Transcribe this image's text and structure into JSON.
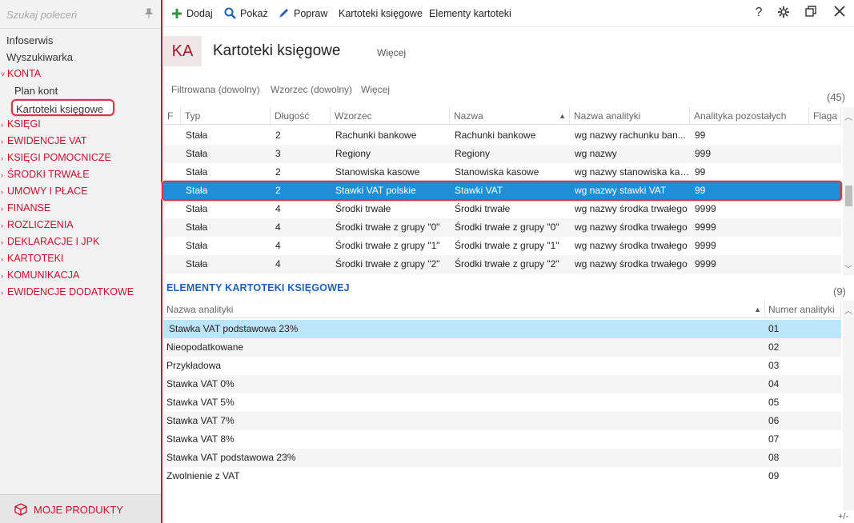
{
  "sidebar": {
    "search_placeholder": "Szukaj poleceń",
    "items": [
      {
        "label": "Infoserwis",
        "kind": "plain"
      },
      {
        "label": "Wyszukiwarka",
        "kind": "plain"
      },
      {
        "label": "KONTA",
        "kind": "section-open"
      },
      {
        "label": "Plan kont",
        "kind": "sub"
      },
      {
        "label": "Kartoteki księgowe",
        "kind": "sub-active"
      },
      {
        "label": "KSIĘGI",
        "kind": "section"
      },
      {
        "label": "EWIDENCJE VAT",
        "kind": "section"
      },
      {
        "label": "KSIĘGI POMOCNICZE",
        "kind": "section"
      },
      {
        "label": "ŚRODKI TRWAŁE",
        "kind": "section"
      },
      {
        "label": "UMOWY I PŁACE",
        "kind": "section"
      },
      {
        "label": "FINANSE",
        "kind": "section"
      },
      {
        "label": "ROZLICZENIA",
        "kind": "section"
      },
      {
        "label": "DEKLARACJE I JPK",
        "kind": "section"
      },
      {
        "label": "KARTOTEKI",
        "kind": "section"
      },
      {
        "label": "KOMUNIKACJA",
        "kind": "section"
      },
      {
        "label": "EWIDENCJE DODATKOWE",
        "kind": "section"
      }
    ],
    "footer_label": "MOJE PRODUKTY"
  },
  "toolbar": {
    "add": "Dodaj",
    "show": "Pokaż",
    "edit": "Popraw",
    "cards": "Kartoteki księgowe",
    "elements": "Elementy kartoteki"
  },
  "header": {
    "badge": "KA",
    "title": "Kartoteki księgowe",
    "more": "Więcej"
  },
  "filters": {
    "filtered": "Filtrowana (dowolny)",
    "pattern": "Wzorzec (dowolny)",
    "more": "Więcej",
    "count": "(45)"
  },
  "table1": {
    "columns": [
      "F",
      "Typ",
      "Długość",
      "Wzorzec",
      "Nazwa",
      "Nazwa analityki",
      "Analityka pozostałych",
      "Flaga"
    ],
    "rows": [
      [
        "",
        "Stała",
        "2",
        "Rachunki bankowe",
        "Rachunki bankowe",
        "wg nazwy rachunku ban...",
        "99",
        ""
      ],
      [
        "",
        "Stała",
        "3",
        "Regiony",
        "Regiony",
        "wg nazwy",
        "999",
        ""
      ],
      [
        "",
        "Stała",
        "2",
        "Stanowiska kasowe",
        "Stanowiska kasowe",
        "wg nazwy stanowiska kas...",
        "99",
        ""
      ],
      [
        "",
        "Stała",
        "2",
        "Stawki VAT polskie",
        "Stawki VAT",
        "wg nazwy stawki VAT",
        "99",
        ""
      ],
      [
        "",
        "Stała",
        "4",
        "Środki trwałe",
        "Środki trwałe",
        "wg nazwy środka trwałego",
        "9999",
        ""
      ],
      [
        "",
        "Stała",
        "4",
        "Środki trwałe z grupy \"0\"",
        "Środki trwałe z grupy \"0\"",
        "wg nazwy środka trwałego",
        "9999",
        ""
      ],
      [
        "",
        "Stała",
        "4",
        "Środki trwałe z grupy \"1\"",
        "Środki trwałe z grupy \"1\"",
        "wg nazwy środka trwałego",
        "9999",
        ""
      ],
      [
        "",
        "Stała",
        "4",
        "Środki trwałe z grupy \"2\"",
        "Środki trwałe z grupy \"2\"",
        "wg nazwy środka trwałego",
        "9999",
        ""
      ]
    ],
    "selected_index": 3
  },
  "section2": {
    "title": "ELEMENTY KARTOTEKI KSIĘGOWEJ",
    "count": "(9)",
    "columns": [
      "Nazwa analityki",
      "Numer analityki"
    ],
    "rows": [
      [
        "Stawka VAT podstawowa 23%",
        "01"
      ],
      [
        "Nieopodatkowane",
        "02"
      ],
      [
        "Przykładowa",
        "03"
      ],
      [
        "Stawka VAT 0%",
        "04"
      ],
      [
        "Stawka VAT 5%",
        "05"
      ],
      [
        "Stawka VAT 7%",
        "06"
      ],
      [
        "Stawka VAT 8%",
        "07"
      ],
      [
        "Stawka VAT podstawowa 23%",
        "08"
      ],
      [
        "Zwolnienie z VAT",
        "09"
      ]
    ],
    "selected_index": 0
  },
  "corner_label": "+/-",
  "colors": {
    "accent": "#c8102e",
    "selection": "#1e8fd6",
    "link_blue": "#1a63b8",
    "highlight_border": "#e0304a"
  }
}
